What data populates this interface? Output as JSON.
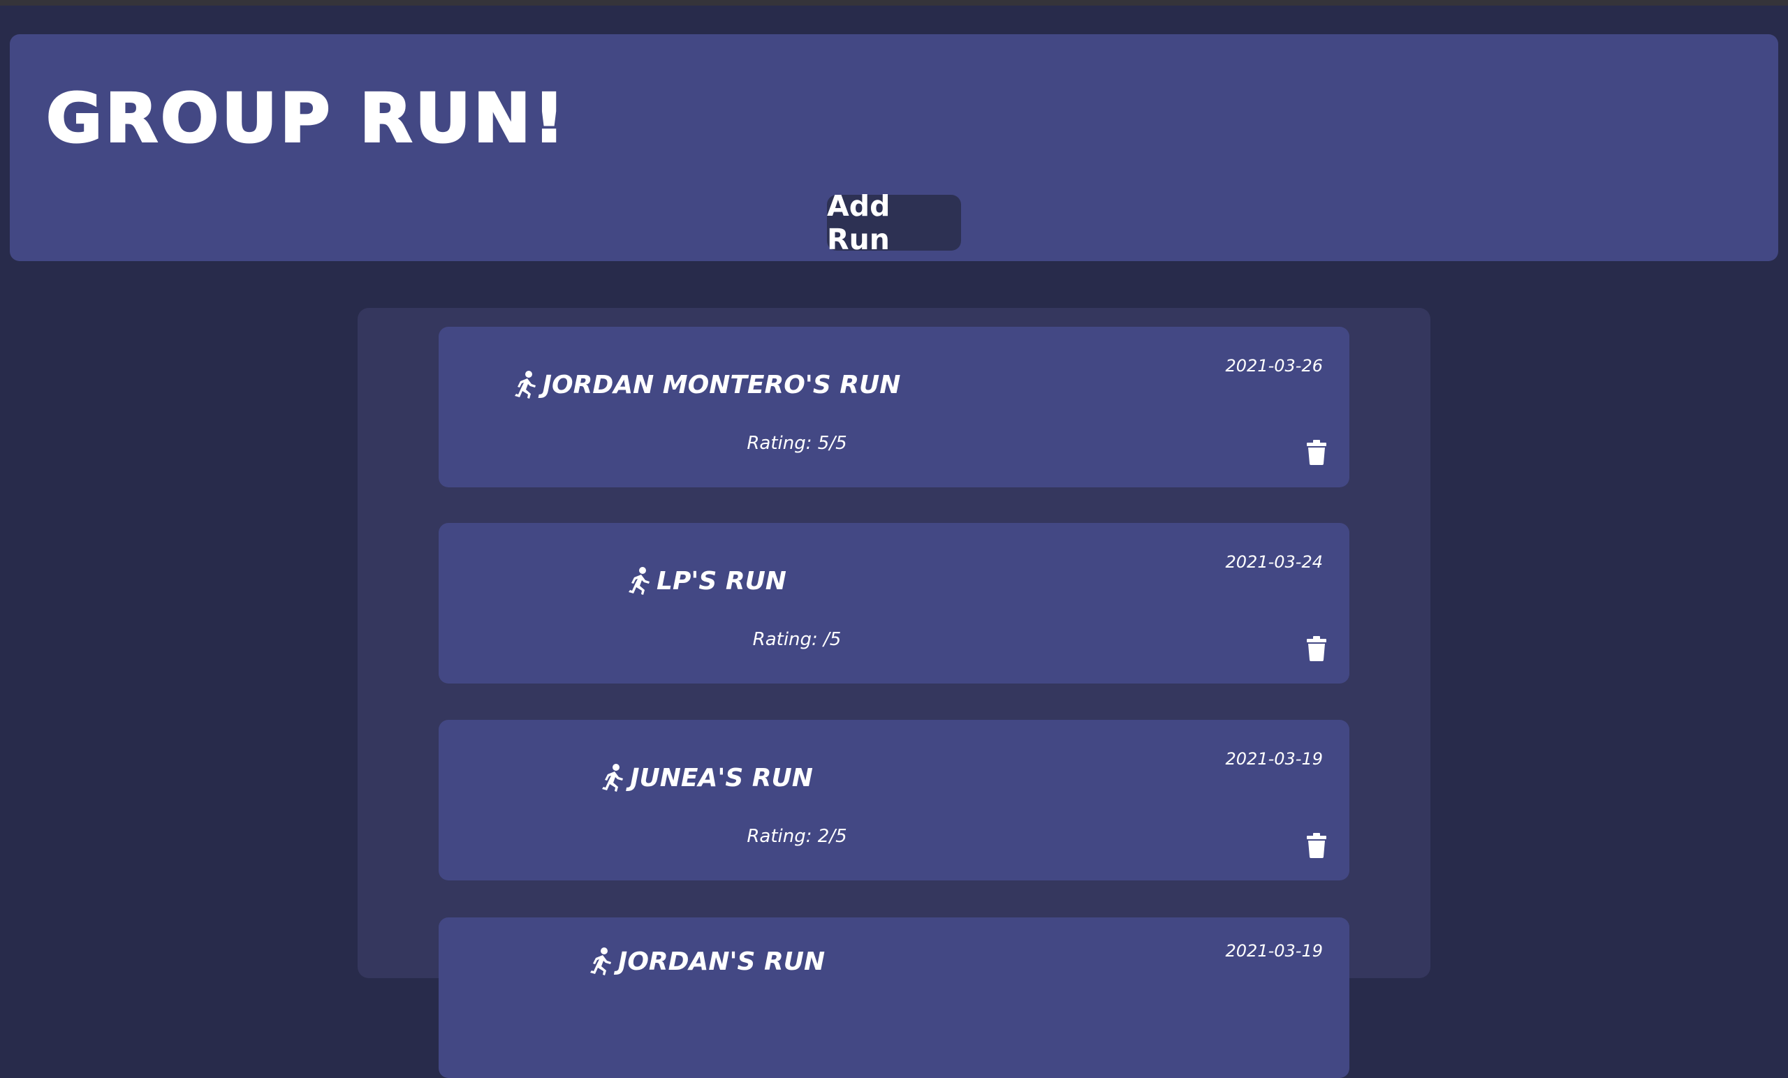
{
  "app": {
    "title": "GROUP RUN!",
    "add_button_label": "Add Run"
  },
  "runs": [
    {
      "title": "JORDAN MONTERO'S RUN",
      "date": "2021-03-26",
      "rating": "Rating: 5/5"
    },
    {
      "title": "LP'S RUN",
      "date": "2021-03-24",
      "rating": "Rating: /5"
    },
    {
      "title": "JUNEA'S RUN",
      "date": "2021-03-19",
      "rating": "Rating: 2/5"
    },
    {
      "title": "JORDAN'S RUN",
      "date": "2021-03-19",
      "rating": ""
    }
  ],
  "icons": {
    "run_icon": "running-person-icon",
    "delete_icon": "trash-icon"
  },
  "colors": {
    "background": "#282b4b",
    "header": "#434884",
    "panel": "#35375e",
    "card": "#434884",
    "button": "#2d3153"
  }
}
